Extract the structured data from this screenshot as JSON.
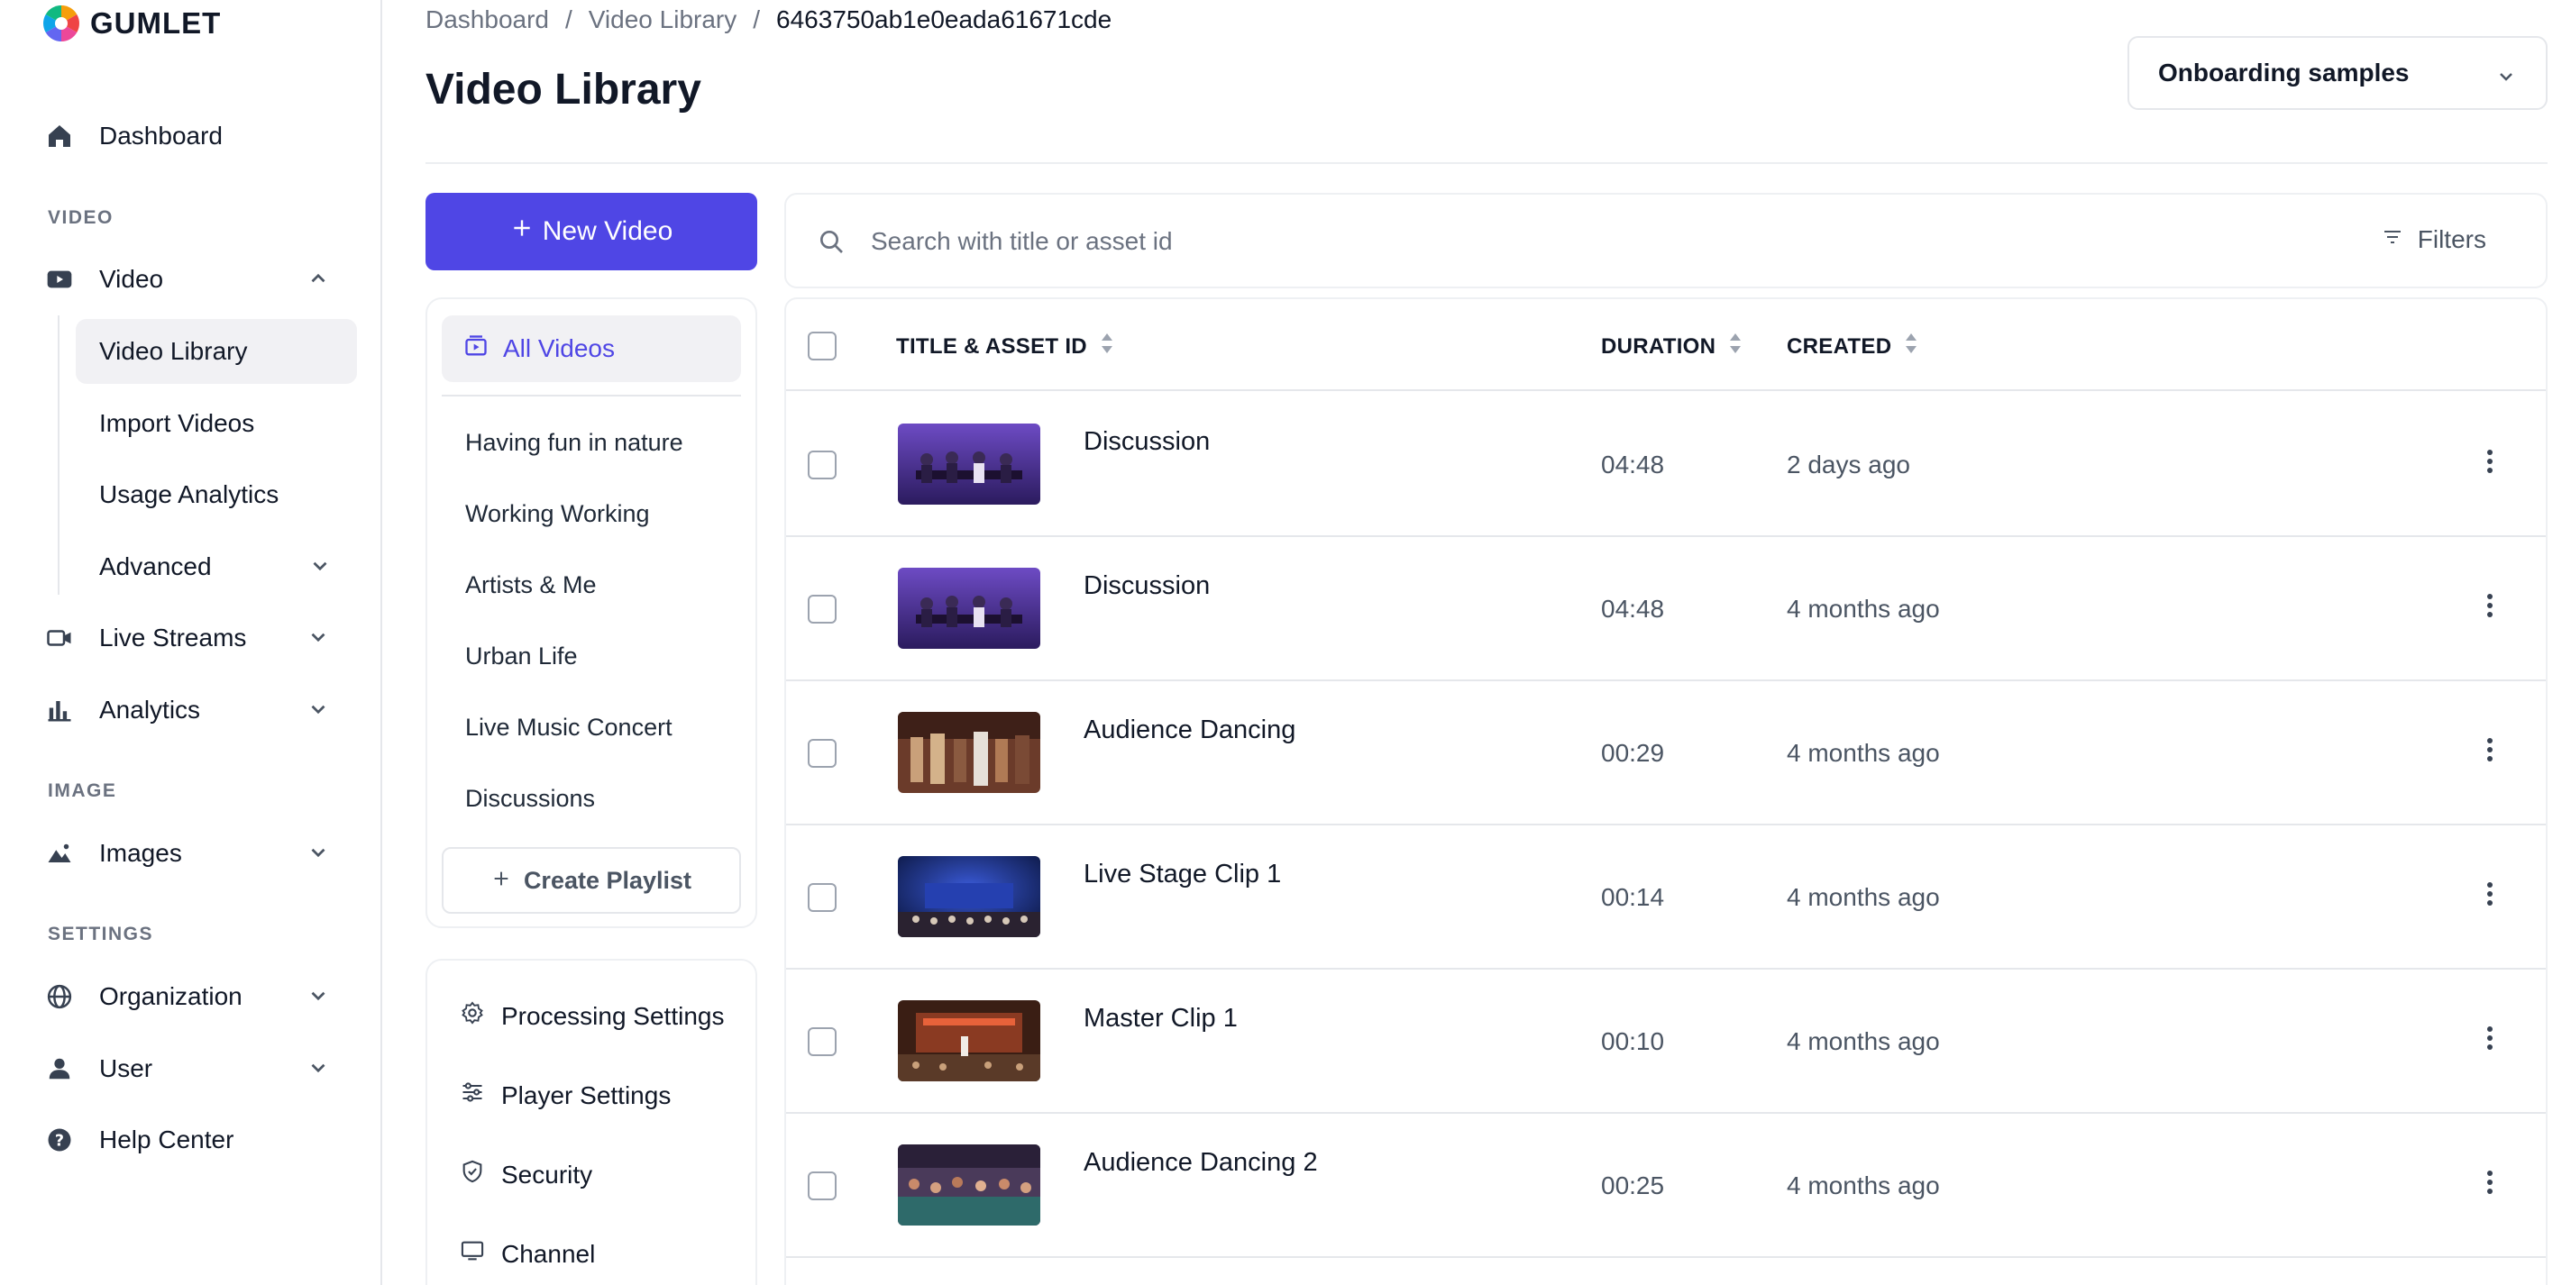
{
  "brand": {
    "name": "GUMLET"
  },
  "sidebar": {
    "dashboard": "Dashboard",
    "sections": {
      "video": "VIDEO",
      "image": "IMAGE",
      "settings": "SETTINGS"
    },
    "video": "Video",
    "video_sub": [
      "Video Library",
      "Import Videos",
      "Usage Analytics",
      "Advanced"
    ],
    "live_streams": "Live Streams",
    "analytics": "Analytics",
    "images": "Images",
    "organization": "Organization",
    "user": "User",
    "help_center": "Help Center"
  },
  "breadcrumb": {
    "items": [
      "Dashboard",
      "Video Library",
      "6463750ab1e0eada61671cde"
    ],
    "separator": "/"
  },
  "page": {
    "title": "Video Library"
  },
  "workspace": {
    "selected": "Onboarding samples"
  },
  "actions": {
    "new_video": "New Video"
  },
  "playlists": {
    "all_videos": "All Videos",
    "items": [
      "Having fun in nature",
      "Working Working",
      "Artists & Me",
      "Urban Life",
      "Live Music Concert",
      "Discussions"
    ],
    "create": "Create Playlist"
  },
  "settings_menu": [
    "Processing Settings",
    "Player Settings",
    "Security",
    "Channel"
  ],
  "search": {
    "placeholder": "Search with title or asset id",
    "value": ""
  },
  "filters": {
    "label": "Filters"
  },
  "table": {
    "columns": {
      "title": "TITLE & ASSET ID",
      "duration": "DURATION",
      "created": "CREATED"
    },
    "rows": [
      {
        "title": "Discussion",
        "duration": "04:48",
        "created": "2 days ago"
      },
      {
        "title": "Discussion",
        "duration": "04:48",
        "created": "4 months ago"
      },
      {
        "title": "Audience Dancing",
        "duration": "00:29",
        "created": "4 months ago"
      },
      {
        "title": "Live Stage Clip 1",
        "duration": "00:14",
        "created": "4 months ago"
      },
      {
        "title": "Master Clip 1",
        "duration": "00:10",
        "created": "4 months ago"
      },
      {
        "title": "Audience Dancing 2",
        "duration": "00:25",
        "created": "4 months ago"
      }
    ]
  },
  "colors": {
    "accent": "#4f46e5",
    "active_bg": "#f1f1f4",
    "border": "#e5e7eb"
  },
  "icons": {
    "dashboard": "home-icon",
    "video": "video-icon",
    "live": "camera-icon",
    "analytics": "bar-chart-icon",
    "images": "image-icon",
    "organization": "globe-icon",
    "user": "user-icon",
    "help": "help-icon"
  }
}
